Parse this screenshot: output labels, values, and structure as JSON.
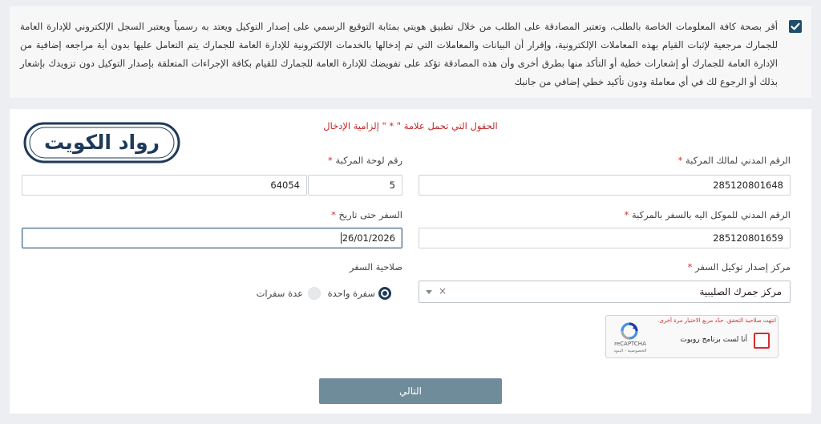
{
  "consent": {
    "checked": true,
    "text": "أقر بصحة كافة المعلومات الخاصة بالطلب، وتعتبر المصادقة على الطلب من خلال تطبيق هويتي بمثابة التوقيع الرسمي على إصدار التوكيل ويعتد به رسمياً ويعتبر السجل الإلكتروني للإدارة العامة للجمارك مرجعية لإثبات القيام بهذه المعاملات الإلكترونية، وإقرار أن البيانات والمعاملات التي تم إدخالها بالخدمات الإلكترونية للإدارة العامة للجمارك يتم التعامل عليها بدون أية مراجعه إضافية من الإدارة العامة للجمارك أو إشعارات خطية أو التأكد منها بطرق أخرى وأن هذه المصادقة تؤكد على تفويضك للإدارة العامة للجمارك للقيام بكافة الإجراءات المتعلقة بإصدار التوكيل دون تزويدك بإشعار بذلك أو الرجوع لك في أي معاملة ودون تأكيد خطي إضافي من جانبك"
  },
  "form": {
    "required_note": "الحقول التي تحمل علامة \" * \" إلزامية الإدخال",
    "logo_text": "رواد الكويت",
    "owner_civil_id": {
      "label": "الرقم المدني لمالك المركبة",
      "star": "*",
      "value": "285120801648"
    },
    "plate": {
      "label": "رقم لوحة المركبة",
      "star": "*",
      "part1": "5",
      "part2": "64054"
    },
    "agent_civil_id": {
      "label": "الرقم المدني للموكل اليه بالسفر بالمركبة",
      "star": "*",
      "value": "285120801659"
    },
    "travel_until": {
      "label": "السفر حتى تاريخ",
      "star": "*",
      "value": "26/01/2026"
    },
    "issue_center": {
      "label": "مركز إصدار توكيل السفر",
      "star": "*",
      "value": "مركز جمرك الصليبية",
      "clear": "×"
    },
    "validity": {
      "label": "صلاحية السفر",
      "options": [
        {
          "label": "سفرة واحدة",
          "selected": true
        },
        {
          "label": "عدة سفرات",
          "selected": false
        }
      ]
    },
    "captcha": {
      "error": "انتهت صلاحية التحقق. حدّد مربع الاختيار مرة أخرى.",
      "label": "أنا لست برنامج روبوت",
      "brand": "reCAPTCHA",
      "terms": "الخصوصية - البنود"
    },
    "next_label": "التالي"
  },
  "colors": {
    "accent": "#1f4e6b",
    "button": "#6f8c9b",
    "error": "#c62828",
    "logo": "#1f3a5a"
  }
}
